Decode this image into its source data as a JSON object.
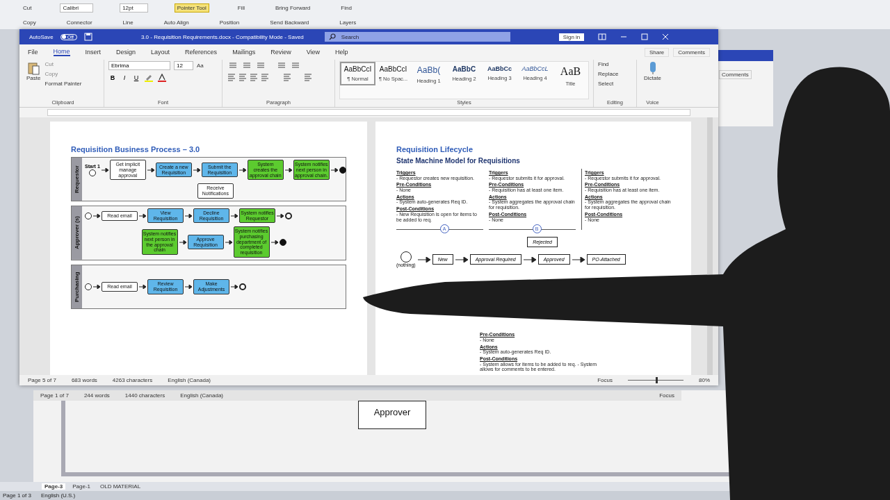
{
  "background_app": {
    "ribbon_rows": [
      [
        {
          "label": "Cut"
        },
        {
          "label": "Calibri",
          "kind": "field"
        },
        {
          "label": "12pt",
          "kind": "field"
        },
        {
          "label": "Pointer Tool",
          "kind": "tool",
          "selected": true
        },
        {
          "label": "Fill"
        },
        {
          "label": "Bring Forward"
        },
        {
          "label": "Find"
        }
      ],
      [
        {
          "label": "Copy"
        },
        {
          "label": "Connector",
          "kind": "tool",
          "selected": false
        },
        {
          "label": "Line"
        },
        {
          "label": "Auto Align"
        },
        {
          "label": "Position"
        },
        {
          "label": "Send Backward"
        },
        {
          "label": "Layers"
        }
      ]
    ],
    "other_window": {
      "button": "Comments"
    },
    "other_status_bar": {
      "page": "Page 1 of 7",
      "words": "244 words",
      "characters": "1440 characters",
      "language": "English (Canada)",
      "focus": "Focus"
    },
    "canvas": {
      "shape": "Approver"
    },
    "sheet_tabs": [
      {
        "label": "Page-3",
        "selected": true
      },
      {
        "label": "Page-1",
        "selected": false
      },
      {
        "label": "OLD MATERIAL",
        "selected": false
      }
    ],
    "status_bar": {
      "page": "Page 1 of 3",
      "language": "English (U.S.)"
    }
  },
  "window": {
    "title": "3.0 - Requisition Requirements.docx  -  Compatibility Mode  -  Saved",
    "autosave": {
      "label": "AutoSave",
      "on": false,
      "state_text": "Off"
    },
    "search": {
      "placeholder": "Search"
    },
    "sign_in": "Sign in"
  },
  "tabs": [
    {
      "label": "File",
      "selected": false
    },
    {
      "label": "Home",
      "selected": true
    },
    {
      "label": "Insert",
      "selected": false
    },
    {
      "label": "Design",
      "selected": false
    },
    {
      "label": "Layout",
      "selected": false
    },
    {
      "label": "References",
      "selected": false
    },
    {
      "label": "Mailings",
      "selected": false
    },
    {
      "label": "Review",
      "selected": false
    },
    {
      "label": "View",
      "selected": false
    },
    {
      "label": "Help",
      "selected": false
    }
  ],
  "share": "Share",
  "comments": "Comments",
  "ribbon": {
    "clipboard": {
      "title": "Clipboard",
      "paste": "Paste",
      "cut": "Cut",
      "copy": "Copy",
      "format_painter": "Format Painter"
    },
    "font": {
      "title": "Font",
      "family": "Ebrima",
      "size": "12",
      "case": "Aa",
      "bold": "B",
      "italic": "I",
      "underline": "U"
    },
    "paragraph": {
      "title": "Paragraph"
    },
    "styles": {
      "title": "Styles",
      "items": [
        {
          "preview": "AaBbCcI",
          "name": "¶ Normal",
          "kind": "normal",
          "selected": true
        },
        {
          "preview": "AaBbCcI",
          "name": "¶ No Spac...",
          "kind": "normal",
          "selected": false
        },
        {
          "preview": "AaBb(",
          "name": "Heading 1",
          "kind": "h1",
          "selected": false
        },
        {
          "preview": "AaBbC",
          "name": "Heading 2",
          "kind": "h2",
          "selected": false
        },
        {
          "preview": "AaBbCc",
          "name": "Heading 3",
          "kind": "h3",
          "selected": false
        },
        {
          "preview": "AaBbCcL",
          "name": "Heading 4",
          "kind": "h4",
          "selected": false
        },
        {
          "preview": "AaB",
          "name": "Title",
          "kind": "title",
          "selected": false
        }
      ]
    },
    "editing": {
      "title": "Editing",
      "items": [
        "Find",
        "Replace",
        "Select"
      ]
    },
    "voice": {
      "title": "Voice",
      "dictate": "Dictate"
    }
  },
  "left_page": {
    "title": "Requisition Business Process – 3.0",
    "lanes": [
      {
        "name": "Requestor",
        "flow": [
          {
            "kind": "start",
            "label": "Start 1"
          },
          {
            "kind": "task",
            "label": "Get implicit manage approval"
          },
          {
            "kind": "user",
            "label": "Create a new Requisition"
          },
          {
            "kind": "user",
            "label": "Submit the Requisition"
          },
          {
            "kind": "system",
            "label": "System creates the approval chain"
          },
          {
            "kind": "system",
            "label": "System notifies next person in approval chain."
          },
          {
            "kind": "end"
          }
        ],
        "branch": [
          {
            "kind": "task",
            "label": "Receive Notifications"
          }
        ]
      },
      {
        "name": "Approver (s)",
        "flow": [
          {
            "kind": "start"
          },
          {
            "kind": "task",
            "label": "Read email"
          },
          {
            "kind": "user",
            "label": "View Requisition"
          },
          {
            "kind": "user",
            "label": "Decline Requisition"
          },
          {
            "kind": "system",
            "label": "System notifies Requestor"
          },
          {
            "kind": "finish"
          }
        ],
        "branch": [
          {
            "kind": "system",
            "label": "System notifies next person in the approval chain"
          },
          {
            "kind": "user",
            "label": "Approve Requisition"
          },
          {
            "kind": "system",
            "label": "System notifies purchasing department of completed requisition"
          },
          {
            "kind": "end"
          }
        ]
      },
      {
        "name": "Purchasing",
        "flow": [
          {
            "kind": "start"
          },
          {
            "kind": "task",
            "label": "Read email"
          },
          {
            "kind": "user",
            "label": "Review Requisition"
          },
          {
            "kind": "user",
            "label": "Make Adjustments"
          },
          {
            "kind": "finish"
          }
        ]
      }
    ]
  },
  "right_page": {
    "title": "Requisition Lifecycle",
    "subtitle": "State Machine Model for Requisitions",
    "notes": [
      {
        "marker": "A",
        "sections": [
          {
            "heading": "Triggers",
            "text": "- Requestor creates new requisition."
          },
          {
            "heading": "Pre-Conditions",
            "text": "- None"
          },
          {
            "heading": "Actions",
            "text": "- System auto-generates Req ID."
          },
          {
            "heading": "Post-Conditions",
            "text": "- New Requisition is open for items to be added to req."
          }
        ]
      },
      {
        "marker": "B",
        "sections": [
          {
            "heading": "Triggers",
            "text": "- Requestor submits it for approval."
          },
          {
            "heading": "Pre-Conditions",
            "text": "- Requisition has at least one item."
          },
          {
            "heading": "Actions",
            "text": "- System aggregates the approval chain for requisition."
          },
          {
            "heading": "Post-Conditions",
            "text": "- None"
          }
        ]
      },
      {
        "sections": [
          {
            "heading": "Triggers",
            "text": "- Requestor submits it for approval."
          },
          {
            "heading": "Pre-Conditions",
            "text": "- Requisition has at least one item."
          },
          {
            "heading": "Actions",
            "text": "- System aggregates the approval chain for requisition."
          },
          {
            "heading": "Post-Conditions",
            "text": "- None"
          }
        ]
      }
    ],
    "rejected": "Rejected",
    "start_label": "(nothing)",
    "states": [
      "New",
      "Approval Required",
      "Approved",
      "PO-Attached"
    ],
    "bottom_note": {
      "sections": [
        {
          "heading": "Pre-Conditions",
          "text": "- None"
        },
        {
          "heading": "Actions",
          "text": "- System auto-generates Req ID."
        },
        {
          "heading": "Post-Conditions",
          "text": "- System allows for items to be added to req. - System allows for comments to be entered."
        }
      ]
    }
  },
  "status_bar": {
    "page": "Page 5 of 7",
    "words": "683 words",
    "characters": "4263 characters",
    "language": "English (Canada)",
    "focus": "Focus",
    "zoom_slider": {
      "level": 0.5
    },
    "zoom": "80%"
  }
}
